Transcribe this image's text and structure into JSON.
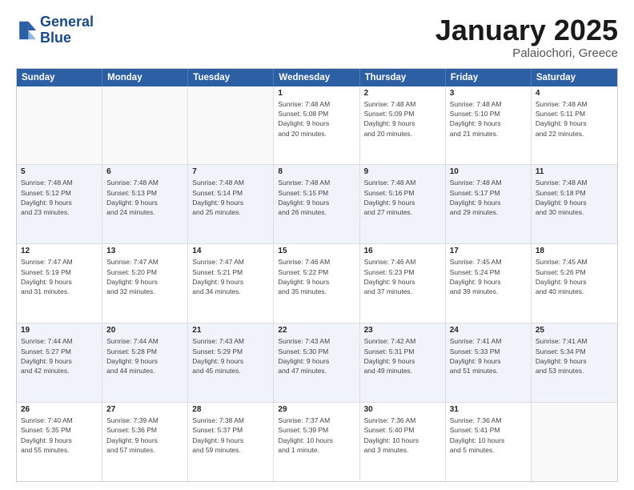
{
  "header": {
    "logo_line1": "General",
    "logo_line2": "Blue",
    "main_title": "January 2025",
    "subtitle": "Palaiochori, Greece"
  },
  "calendar": {
    "days_of_week": [
      "Sunday",
      "Monday",
      "Tuesday",
      "Wednesday",
      "Thursday",
      "Friday",
      "Saturday"
    ],
    "rows": [
      [
        {
          "day": "",
          "info": ""
        },
        {
          "day": "",
          "info": ""
        },
        {
          "day": "",
          "info": ""
        },
        {
          "day": "1",
          "info": "Sunrise: 7:48 AM\nSunset: 5:08 PM\nDaylight: 9 hours\nand 20 minutes."
        },
        {
          "day": "2",
          "info": "Sunrise: 7:48 AM\nSunset: 5:09 PM\nDaylight: 9 hours\nand 20 minutes."
        },
        {
          "day": "3",
          "info": "Sunrise: 7:48 AM\nSunset: 5:10 PM\nDaylight: 9 hours\nand 21 minutes."
        },
        {
          "day": "4",
          "info": "Sunrise: 7:48 AM\nSunset: 5:11 PM\nDaylight: 9 hours\nand 22 minutes."
        }
      ],
      [
        {
          "day": "5",
          "info": "Sunrise: 7:48 AM\nSunset: 5:12 PM\nDaylight: 9 hours\nand 23 minutes."
        },
        {
          "day": "6",
          "info": "Sunrise: 7:48 AM\nSunset: 5:13 PM\nDaylight: 9 hours\nand 24 minutes."
        },
        {
          "day": "7",
          "info": "Sunrise: 7:48 AM\nSunset: 5:14 PM\nDaylight: 9 hours\nand 25 minutes."
        },
        {
          "day": "8",
          "info": "Sunrise: 7:48 AM\nSunset: 5:15 PM\nDaylight: 9 hours\nand 26 minutes."
        },
        {
          "day": "9",
          "info": "Sunrise: 7:48 AM\nSunset: 5:16 PM\nDaylight: 9 hours\nand 27 minutes."
        },
        {
          "day": "10",
          "info": "Sunrise: 7:48 AM\nSunset: 5:17 PM\nDaylight: 9 hours\nand 29 minutes."
        },
        {
          "day": "11",
          "info": "Sunrise: 7:48 AM\nSunset: 5:18 PM\nDaylight: 9 hours\nand 30 minutes."
        }
      ],
      [
        {
          "day": "12",
          "info": "Sunrise: 7:47 AM\nSunset: 5:19 PM\nDaylight: 9 hours\nand 31 minutes."
        },
        {
          "day": "13",
          "info": "Sunrise: 7:47 AM\nSunset: 5:20 PM\nDaylight: 9 hours\nand 32 minutes."
        },
        {
          "day": "14",
          "info": "Sunrise: 7:47 AM\nSunset: 5:21 PM\nDaylight: 9 hours\nand 34 minutes."
        },
        {
          "day": "15",
          "info": "Sunrise: 7:46 AM\nSunset: 5:22 PM\nDaylight: 9 hours\nand 35 minutes."
        },
        {
          "day": "16",
          "info": "Sunrise: 7:46 AM\nSunset: 5:23 PM\nDaylight: 9 hours\nand 37 minutes."
        },
        {
          "day": "17",
          "info": "Sunrise: 7:45 AM\nSunset: 5:24 PM\nDaylight: 9 hours\nand 39 minutes."
        },
        {
          "day": "18",
          "info": "Sunrise: 7:45 AM\nSunset: 5:26 PM\nDaylight: 9 hours\nand 40 minutes."
        }
      ],
      [
        {
          "day": "19",
          "info": "Sunrise: 7:44 AM\nSunset: 5:27 PM\nDaylight: 9 hours\nand 42 minutes."
        },
        {
          "day": "20",
          "info": "Sunrise: 7:44 AM\nSunset: 5:28 PM\nDaylight: 9 hours\nand 44 minutes."
        },
        {
          "day": "21",
          "info": "Sunrise: 7:43 AM\nSunset: 5:29 PM\nDaylight: 9 hours\nand 45 minutes."
        },
        {
          "day": "22",
          "info": "Sunrise: 7:43 AM\nSunset: 5:30 PM\nDaylight: 9 hours\nand 47 minutes."
        },
        {
          "day": "23",
          "info": "Sunrise: 7:42 AM\nSunset: 5:31 PM\nDaylight: 9 hours\nand 49 minutes."
        },
        {
          "day": "24",
          "info": "Sunrise: 7:41 AM\nSunset: 5:33 PM\nDaylight: 9 hours\nand 51 minutes."
        },
        {
          "day": "25",
          "info": "Sunrise: 7:41 AM\nSunset: 5:34 PM\nDaylight: 9 hours\nand 53 minutes."
        }
      ],
      [
        {
          "day": "26",
          "info": "Sunrise: 7:40 AM\nSunset: 5:35 PM\nDaylight: 9 hours\nand 55 minutes."
        },
        {
          "day": "27",
          "info": "Sunrise: 7:39 AM\nSunset: 5:36 PM\nDaylight: 9 hours\nand 57 minutes."
        },
        {
          "day": "28",
          "info": "Sunrise: 7:38 AM\nSunset: 5:37 PM\nDaylight: 9 hours\nand 59 minutes."
        },
        {
          "day": "29",
          "info": "Sunrise: 7:37 AM\nSunset: 5:39 PM\nDaylight: 10 hours\nand 1 minute."
        },
        {
          "day": "30",
          "info": "Sunrise: 7:36 AM\nSunset: 5:40 PM\nDaylight: 10 hours\nand 3 minutes."
        },
        {
          "day": "31",
          "info": "Sunrise: 7:36 AM\nSunset: 5:41 PM\nDaylight: 10 hours\nand 5 minutes."
        },
        {
          "day": "",
          "info": ""
        }
      ]
    ]
  }
}
